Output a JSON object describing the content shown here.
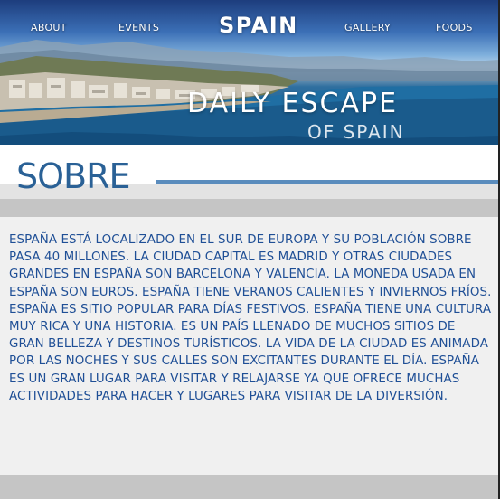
{
  "nav": {
    "about": "ABOUT",
    "events": "EVENTS",
    "brand": "SPAIN",
    "gallery": "GALLERY",
    "foods": "FOODS"
  },
  "hero": {
    "title": "DAILY ESCAPE",
    "subtitle": "OF SPAIN"
  },
  "section": {
    "title": "SOBRE",
    "body": "España está localizado en el sur de Europa y su población sobre pasa 40 millones. La ciudad capital es Madrid y otras ciudades grandes en España son Barcelona y Valencia. La moneda usada en España son euros. España tiene veranos calientes y inviernos fríos. España es sitio popular para días festivos. España tiene una cultura muy rica y una historia. Es un país llenado de muchos sitios de gran belleza y destinos turísticos. La vida de la ciudad es animada por las noches y sus calles son excitantes durante el día. España es un gran lugar para visitar y relajarse ya que ofrece muchas actividades para hacer y lugares para visitar de la diversión."
  },
  "colors": {
    "accent": "#2a6196",
    "text": "#1f4f96",
    "rule": "#5a8cbd",
    "band": "#c5c5c5"
  }
}
